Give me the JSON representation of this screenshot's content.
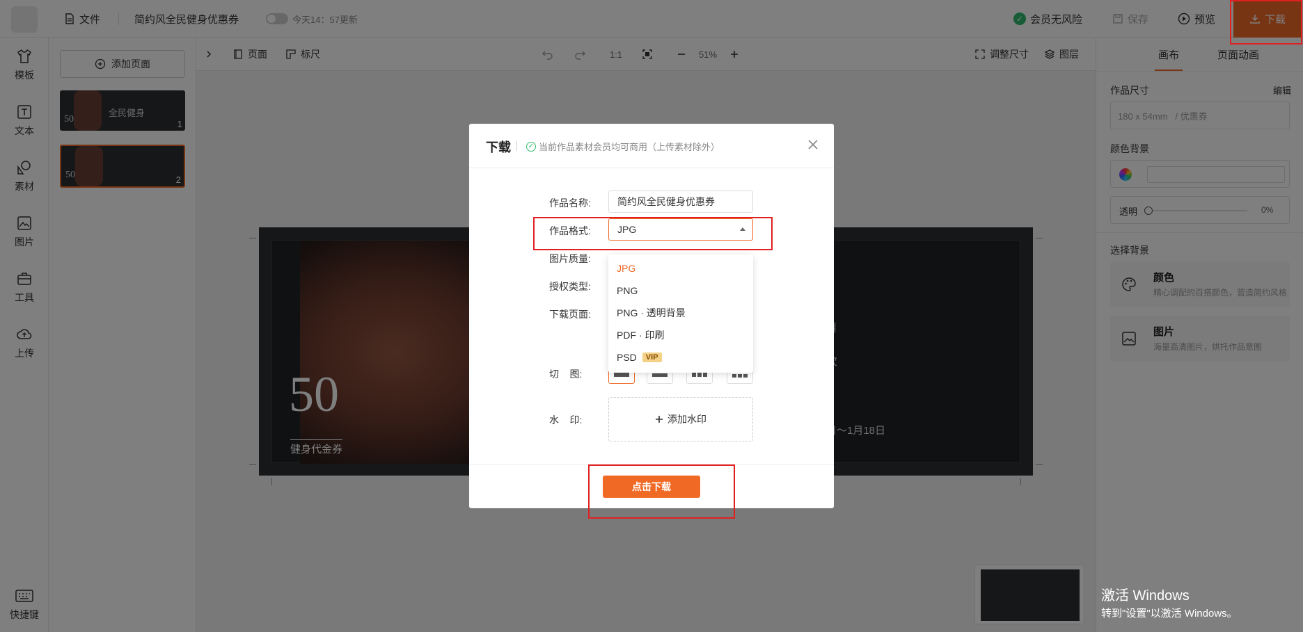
{
  "header": {
    "file_label": "文件",
    "doc_title": "简约风全民健身优惠券",
    "autosave_text": "今天14：57更新",
    "member_risk": "会员无风险",
    "save_label": "保存",
    "preview_label": "预览",
    "download_label": "下载"
  },
  "rail": {
    "items": [
      {
        "label": "模板",
        "icon": "tshirt-icon"
      },
      {
        "label": "文本",
        "icon": "text-icon"
      },
      {
        "label": "素材",
        "icon": "shapes-icon"
      },
      {
        "label": "图片",
        "icon": "image-icon"
      },
      {
        "label": "工具",
        "icon": "toolbox-icon"
      },
      {
        "label": "上传",
        "icon": "cloud-upload-icon"
      }
    ],
    "shortcut_label": "快捷键"
  },
  "pages": {
    "add_label": "添加页面",
    "thumbs": [
      {
        "title": "全民健身",
        "value": "50",
        "number": "1"
      },
      {
        "value": "50",
        "number": "2"
      }
    ]
  },
  "toolbar": {
    "page_label": "页面",
    "ruler_label": "标尺",
    "ratio_label": "1:1",
    "zoom": "51%",
    "resize_label": "调整尺寸",
    "layers_label": "图层"
  },
  "canvas": {
    "big_number": "50",
    "coupon_label": "健身代金券",
    "date_fragment": "日～1月18日",
    "frag_1": "月",
    "frag_2": "次"
  },
  "right_panel": {
    "tab_canvas": "画布",
    "tab_animation": "页面动画",
    "size_label": "作品尺寸",
    "edit_label": "编辑",
    "size_value": "180 x 54mm   / 优惠券",
    "color_bg_label": "颜色背景",
    "opacity_label": "透明",
    "opacity_value": "0%",
    "choose_bg_label": "选择背景",
    "color_card_title": "颜色",
    "color_card_sub": "精心调配的百搭颜色，营造简约风格",
    "image_card_title": "图片",
    "image_card_sub": "海量高清图片，烘托作品意图"
  },
  "modal": {
    "title": "下载",
    "note": "当前作品素材会员均可商用（上传素材除外）",
    "name_label": "作品名称:",
    "name_value": "简约风全民健身优惠券",
    "format_label": "作品格式:",
    "format_value": "JPG",
    "quality_label": "图片质量:",
    "license_label": "授权类型:",
    "pages_label": "下载页面:",
    "slice_label": "切    图:",
    "watermark_label": "水    印:",
    "watermark_add": "添加水印",
    "download_button": "点击下载",
    "format_options": [
      {
        "label": "JPG",
        "selected": true
      },
      {
        "label": "PNG"
      },
      {
        "label": "PNG · 透明背景"
      },
      {
        "label": "PDF · 印刷"
      },
      {
        "label": "PSD",
        "badge": "VIP"
      }
    ]
  },
  "windows_activation": {
    "line1": "激活 Windows",
    "line2": "转到\"设置\"以激活 Windows。"
  },
  "colors": {
    "accent": "#f06a26",
    "highlight": "#e02020",
    "success": "#2fb86b"
  }
}
